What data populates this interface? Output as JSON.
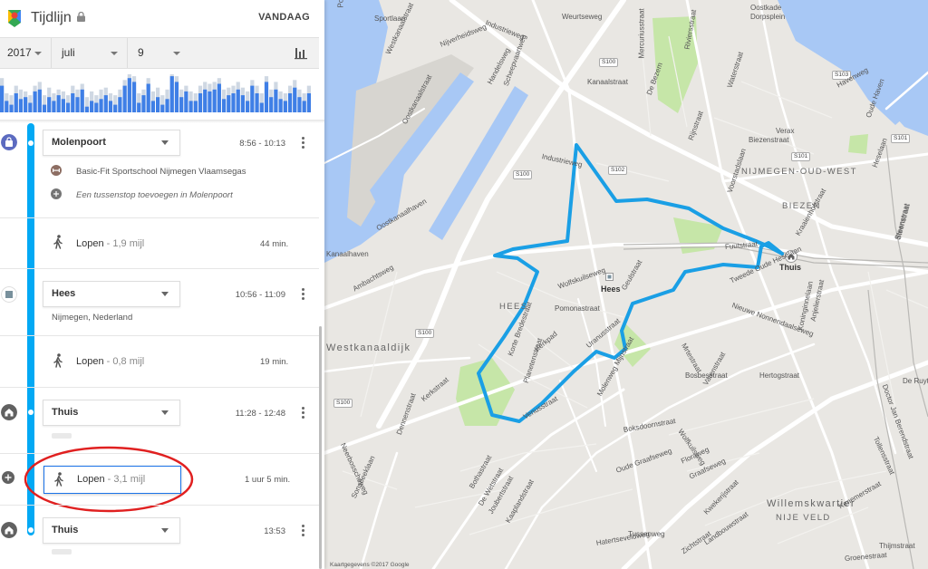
{
  "header": {
    "title": "Tijdlijn",
    "today_button": "VANDAAG"
  },
  "date_selector": {
    "year": "2017",
    "month": "juli",
    "day": "9"
  },
  "histogram": {
    "bars": [
      0.7,
      0.3,
      0.2,
      0.5,
      0.35,
      0.4,
      0.25,
      0.55,
      0.6,
      0.2,
      0.4,
      0.3,
      0.45,
      0.35,
      0.25,
      0.5,
      0.4,
      0.6,
      0.15,
      0.3,
      0.25,
      0.35,
      0.45,
      0.3,
      0.2,
      0.4,
      0.7,
      0.9,
      0.8,
      0.25,
      0.45,
      0.75,
      0.3,
      0.4,
      0.2,
      0.35,
      0.95,
      0.8,
      0.4,
      0.55,
      0.3,
      0.3,
      0.5,
      0.6,
      0.55,
      0.6,
      0.75,
      0.35,
      0.45,
      0.5,
      0.6,
      0.45,
      0.3,
      0.7,
      0.5,
      0.25,
      0.8,
      0.4,
      0.6,
      0.35,
      0.3,
      0.5,
      0.65,
      0.4,
      0.3,
      0.5
    ],
    "shadow": [
      0.9,
      0.5,
      0.45,
      0.7,
      0.6,
      0.55,
      0.45,
      0.7,
      0.8,
      0.45,
      0.65,
      0.5,
      0.6,
      0.55,
      0.45,
      0.7,
      0.6,
      0.75,
      0.4,
      0.55,
      0.45,
      0.6,
      0.65,
      0.5,
      0.45,
      0.6,
      0.85,
      1.0,
      0.95,
      0.5,
      0.6,
      0.9,
      0.55,
      0.65,
      0.45,
      0.6,
      1.0,
      0.95,
      0.6,
      0.7,
      0.55,
      0.5,
      0.7,
      0.8,
      0.75,
      0.8,
      0.9,
      0.6,
      0.65,
      0.7,
      0.8,
      0.65,
      0.55,
      0.85,
      0.7,
      0.5,
      0.95,
      0.6,
      0.8,
      0.55,
      0.5,
      0.7,
      0.85,
      0.6,
      0.5,
      0.7
    ]
  },
  "timeline": {
    "stop1": {
      "name": "Molenpoort",
      "time": "8:56 - 10:13",
      "sub_place": "Basic-Fit Sportschool Nijmegen Vlaamsegas",
      "add_stop": "Een tussenstop toevoegen in Molenpoort"
    },
    "walk1": {
      "label": "Lopen",
      "distance": " - 1,9 mijl",
      "duration": "44 min."
    },
    "stop2": {
      "name": "Hees",
      "time": "10:56 - 11:09",
      "address": "Nijmegen, Nederland"
    },
    "walk2": {
      "label": "Lopen",
      "distance": " - 0,8 mijl",
      "duration": "19 min."
    },
    "stop3": {
      "name": "Thuis",
      "time": "11:28 - 12:48"
    },
    "walk3": {
      "label": "Lopen",
      "distance": " - 3,1 mijl",
      "duration": "1 uur 5 min."
    },
    "stop4": {
      "name": "Thuis",
      "time": "13:53"
    }
  },
  "map": {
    "street_labels": [
      "Postkanaal",
      "Sportlaan",
      "Westkanaalstraat",
      "Industrieweg",
      "Weurtseweg",
      "Oostkade",
      "Dorpsplein",
      "Nijverheidsweg",
      "Scheepvaartweg",
      "Handelsweg",
      "Oostkanaalstraat",
      "Kanaalstraat",
      "Mercuriusstraat",
      "De Bezem",
      "Riviersstraat",
      "Waterstraat",
      "Verax",
      "Havenweg",
      "Biezenstraat",
      "Rijnstraat",
      "Voorstadslaan",
      "Heselaan",
      "Oude Haven",
      "Industrieweg",
      "Oostkanaalhaven",
      "Kanaalhaven",
      "Ambachtsweg",
      "Fuutstraat",
      "Kraaienhofstraat",
      "Steenstraat",
      "Wolfskuilseweg",
      "Geulstraat",
      "Tweede Oude Heselaan",
      "Pomonastraat",
      "Korte Bredestraat",
      "Kerkpad",
      "Planetenstraat",
      "Uranusstraat",
      "Mijnstraat",
      "Nieuwe Nonnendaalseweg",
      "Hertogstraat",
      "Mrtestraat",
      "Kerkstraat",
      "Venusstraat",
      "Molenweg",
      "Bosbesstraat",
      "Varenstraat",
      "Wolfkuilsweg",
      "Floraweg",
      "Boksdoornstraat",
      "Oude Graafseweg",
      "Graafseweg",
      "Dennenstraat",
      "Neerbosscheweg",
      "Sonsbeeklaan",
      "Bothastraat",
      "De Wetstraat",
      "Joubertstraat",
      "Kaaplandstraat",
      "Groenestraat",
      "Hatertseveldweg",
      "Tussenweg",
      "Landbouwstraat",
      "Zichtstraat",
      "Thijmstraat",
      "Tollensstraat",
      "Doctor Jan Berendstraat",
      "De Ruyter",
      "Kenemerstraat",
      "Kwekerijstraat",
      "Steenstraat",
      "Koninginnelaan",
      "Anjelierstraat"
    ],
    "districts": [
      "NIJMEGEN-OUD-WEST",
      "BIEZEN",
      "HEES",
      "Willemskwartier",
      "NIJE VELD",
      "Westkanaaldijk"
    ],
    "poi": {
      "home": "Thuis",
      "hees": "Hees"
    },
    "roads": [
      "S100",
      "S100",
      "S102",
      "S101",
      "S101",
      "S100",
      "S100",
      "S103"
    ],
    "copyright": "Kaartgegevens ©2017 Google",
    "route_color": "#1a9fe5",
    "water_color": "#a8c8f5",
    "park_color": "#c6e6a8"
  }
}
